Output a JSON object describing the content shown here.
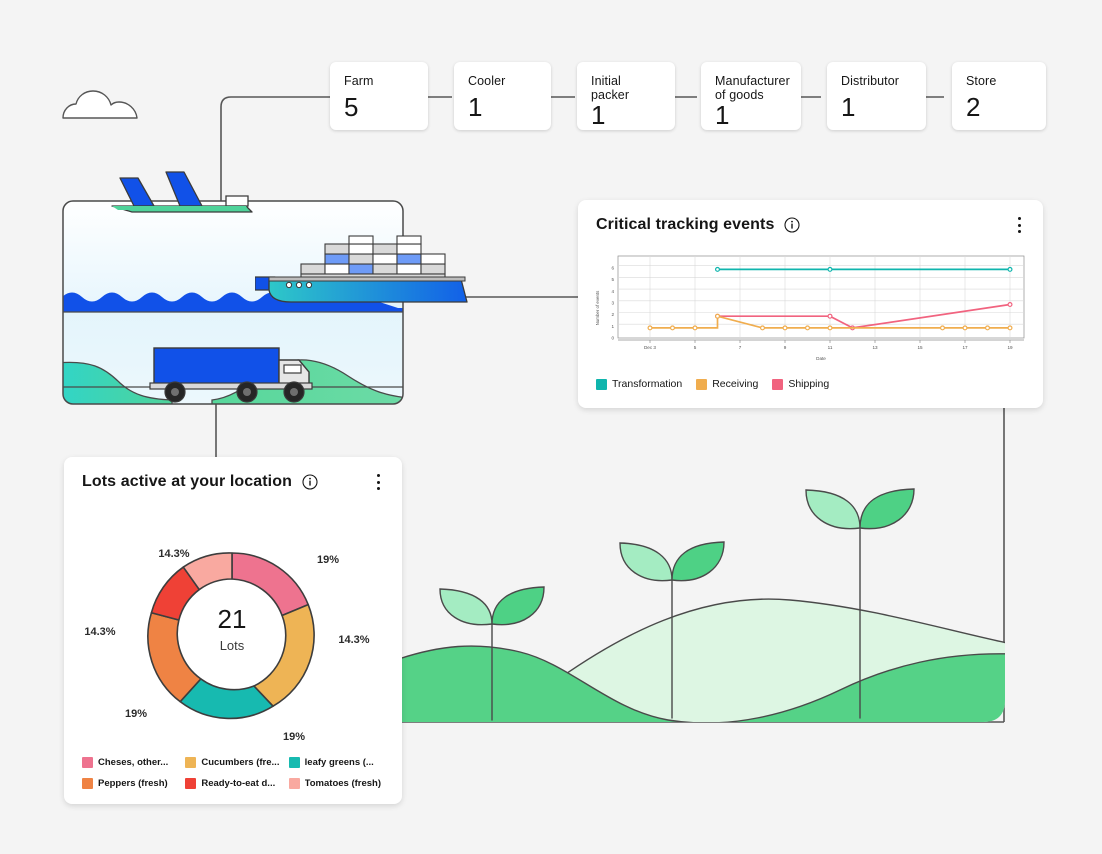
{
  "stat_tiles": [
    {
      "label": "Farm",
      "value": "5"
    },
    {
      "label": "Cooler",
      "value": "1"
    },
    {
      "label": "Initial packer",
      "value": "1"
    },
    {
      "label": "Manufacturer of goods",
      "value": "1"
    },
    {
      "label": "Distributor",
      "value": "1"
    },
    {
      "label": "Store",
      "value": "2"
    }
  ],
  "critical_tracking_events": {
    "title": "Critical tracking events",
    "info_icon": "info-icon",
    "menu_icon": "overflow-menu-icon"
  },
  "lots_active": {
    "title": "Lots active at your location",
    "info_icon": "info-icon",
    "menu_icon": "overflow-menu-icon",
    "center_value": "21",
    "center_label": "Lots"
  },
  "illustration": {
    "cloud_icon": "cloud-icon",
    "plane_icon": "airplane-icon",
    "ship_icon": "cargo-ship-icon",
    "truck_icon": "truck-icon",
    "field_icon": "sprouts-field-icon"
  },
  "chart_data": [
    {
      "type": "line",
      "title": "Critical tracking events",
      "xlabel": "Date",
      "ylabel": "Number of events",
      "ylim": [
        0,
        6
      ],
      "yticks": [
        0,
        1,
        2,
        3,
        4,
        5,
        6
      ],
      "xlim": [
        2,
        20
      ],
      "xticks": [
        3,
        5,
        7,
        9,
        11,
        13,
        15,
        17,
        19
      ],
      "xticklabels": [
        "Dec 3",
        "5",
        "7",
        "9",
        "11",
        "13",
        "15",
        "17",
        "19"
      ],
      "grid": true,
      "legend_position": "bottom-left",
      "series": [
        {
          "name": "Transformation",
          "color": "#0fb5ad",
          "x": [
            6,
            11,
            19
          ],
          "values": [
            6,
            6,
            6
          ]
        },
        {
          "name": "Receiving",
          "color": "#f0ad4e",
          "x": [
            3,
            4,
            5,
            6,
            7,
            8,
            9,
            10,
            11,
            12,
            13,
            16,
            17,
            18,
            19
          ],
          "values": [
            1,
            1,
            1,
            1,
            2,
            1,
            1,
            1,
            1,
            1,
            1,
            1,
            1,
            1,
            1
          ]
        },
        {
          "name": "Shipping",
          "color": "#f1637f",
          "x": [
            6,
            7,
            9,
            11,
            12,
            19
          ],
          "values": [
            2,
            2,
            2,
            2,
            1,
            3
          ]
        }
      ]
    },
    {
      "type": "pie",
      "title": "Lots active at your location",
      "center_value": "21",
      "center_label": "Lots",
      "total": 21,
      "labels": [
        "Cheses, other...",
        "Cucumbers (fre...",
        "leafy greens (...",
        "Peppers (fresh)",
        "Ready-to-eat d...",
        "Tomatoes (fresh)"
      ],
      "values": [
        19,
        14.3,
        19,
        19,
        14.3,
        14.3
      ],
      "value_labels": [
        "19%",
        "14.3%",
        "19%",
        "19%",
        "14.3%",
        "14.3%"
      ],
      "colors": [
        "#ee738f",
        "#eeb455",
        "#17bab0",
        "#ef8344",
        "#ef4136",
        "#f9a9a0"
      ],
      "legend_position": "bottom"
    }
  ],
  "colors": {
    "background": "#f4f4f4",
    "card": "#ffffff",
    "connector": "#565656",
    "transformation": "#0fb5ad",
    "receiving": "#f0ad4e",
    "shipping": "#f1637f"
  }
}
